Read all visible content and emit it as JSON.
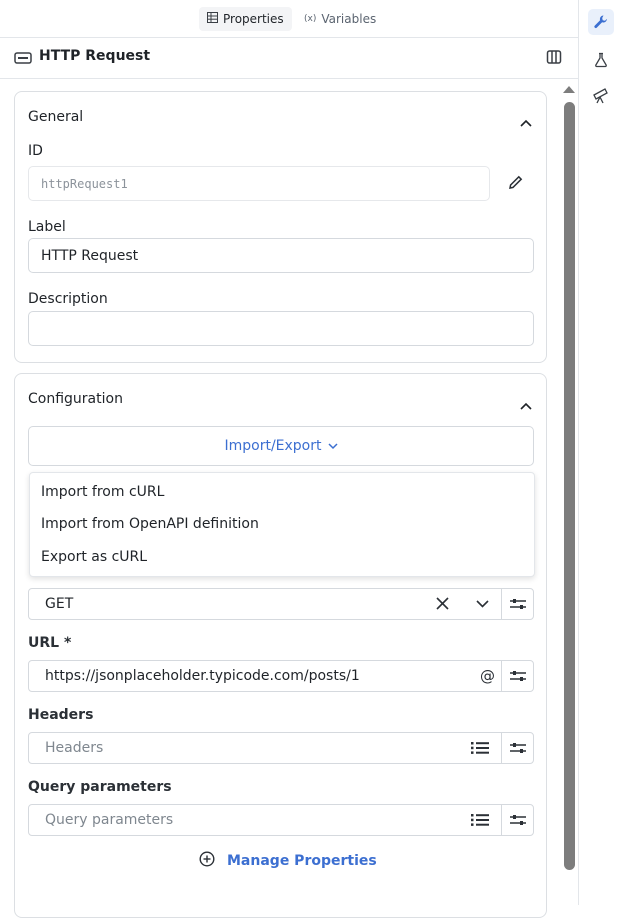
{
  "tabs": [
    {
      "label": "Properties",
      "icon": "table-icon",
      "active": true
    },
    {
      "label": "Variables",
      "icon": "variable-icon",
      "active": false
    }
  ],
  "header": {
    "title": "HTTP Request",
    "icon": "http-node-icon"
  },
  "general": {
    "title": "General",
    "id_label": "ID",
    "id_value": "httpRequest1",
    "label_label": "Label",
    "label_value": "HTTP Request",
    "description_label": "Description",
    "description_value": ""
  },
  "configuration": {
    "title": "Configuration",
    "import_export_label": "Import/Export",
    "menu": [
      "Import from cURL",
      "Import from OpenAPI definition",
      "Export as cURL"
    ],
    "method_value": "GET",
    "url_label": "URL *",
    "url_value": "https://jsonplaceholder.typicode.com/posts/1",
    "headers_label": "Headers",
    "headers_placeholder": "Headers",
    "query_label": "Query parameters",
    "query_placeholder": "Query parameters",
    "manage_label": "Manage Properties"
  },
  "rail": [
    "wrench-icon",
    "flask-icon",
    "telescope-icon"
  ],
  "colors": {
    "accent": "#3c6fd1",
    "border": "#d5d9de"
  }
}
